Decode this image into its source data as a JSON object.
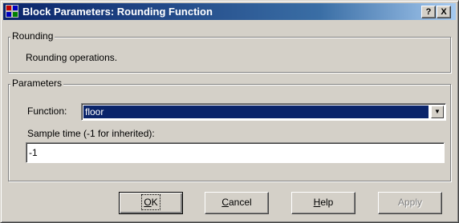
{
  "window": {
    "title": "Block Parameters: Rounding Function",
    "help_button": "?",
    "close_button": "X"
  },
  "rounding_group": {
    "label": "Rounding",
    "description": "Rounding operations."
  },
  "parameters_group": {
    "label": "Parameters",
    "function_label": "Function:",
    "function_value": "floor",
    "sample_time_label": "Sample time (-1 for inherited):",
    "sample_time_value": "-1"
  },
  "buttons": {
    "ok_mnemonic": "O",
    "ok_rest": "K",
    "cancel_mnemonic": "C",
    "cancel_rest": "ancel",
    "help_mnemonic": "H",
    "help_rest": "elp",
    "apply_label": "Apply"
  }
}
